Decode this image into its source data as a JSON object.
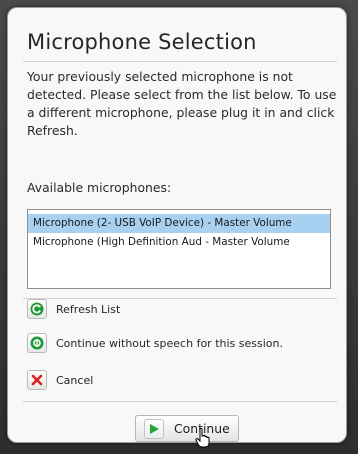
{
  "dialog": {
    "title": "Microphone Selection",
    "message": "Your previously selected microphone is not detected.  Please select from the list below.  To use a different microphone, please plug it in and click Refresh.",
    "available_label": "Available microphones:"
  },
  "microphones": {
    "selected_index": 0,
    "items": [
      "Microphone (2- USB VoIP Device) - Master Volume",
      "Microphone (High Definition Aud - Master Volume"
    ]
  },
  "actions": {
    "refresh_label": "Refresh List",
    "continue_without_speech_label": "Continue without speech for this session.",
    "cancel_label": "Cancel"
  },
  "footer": {
    "continue_label": "Continue"
  },
  "colors": {
    "selection": "#a8d0f0",
    "refresh_icon": "#1f9a36",
    "no_speech_icon": "#1f9a36",
    "cancel_icon": "#d9251d",
    "continue_icon": "#27a33a"
  },
  "icons": {
    "refresh": "refresh-icon",
    "no_speech": "no-speech-icon",
    "cancel": "cancel-x-icon",
    "continue": "play-arrow-icon",
    "cursor": "hand-pointer-cursor"
  }
}
